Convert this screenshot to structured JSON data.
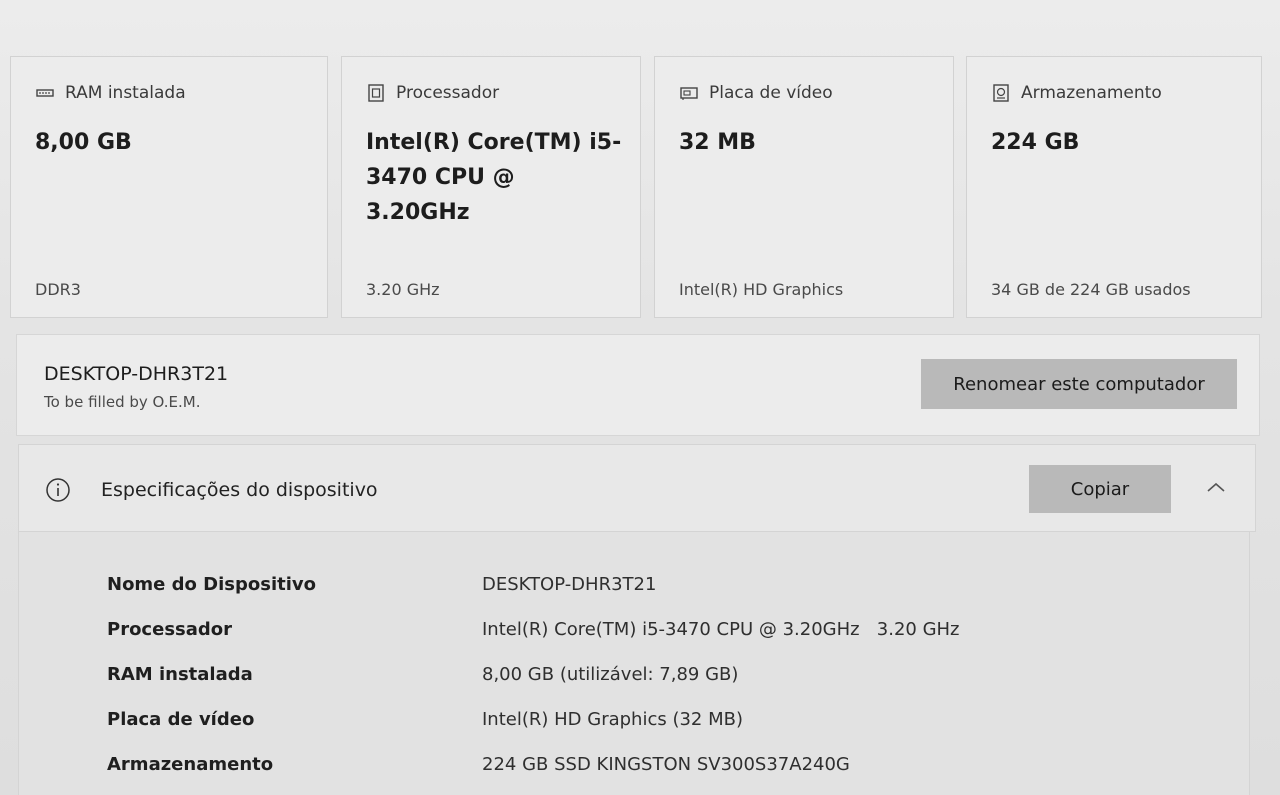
{
  "cards": [
    {
      "icon": "ram-icon",
      "title": "RAM instalada",
      "value": "8,00 GB",
      "footer": "DDR3"
    },
    {
      "icon": "processor-icon",
      "title": "Processador",
      "value": "Intel(R) Core(TM) i5-3470 CPU @ 3.20GHz",
      "footer": "3.20 GHz"
    },
    {
      "icon": "display-adapter-icon",
      "title": "Placa de vídeo",
      "value": "32 MB",
      "footer": "Intel(R) HD Graphics"
    },
    {
      "icon": "storage-icon",
      "title": "Armazenamento",
      "value": "224 GB",
      "footer": "34 GB de 224 GB usados"
    }
  ],
  "computer": {
    "name": "DESKTOP-DHR3T21",
    "subtitle": "To be filled by O.E.M.",
    "rename_label": "Renomear este computador"
  },
  "specs": {
    "title": "Especificações do dispositivo",
    "copy_label": "Copiar",
    "rows": [
      {
        "label": "Nome do Dispositivo",
        "value": "DESKTOP-DHR3T21"
      },
      {
        "label": "Processador",
        "value": "Intel(R) Core(TM) i5-3470 CPU @ 3.20GHz   3.20 GHz"
      },
      {
        "label": "RAM instalada",
        "value": "8,00 GB (utilizável: 7,89 GB)"
      },
      {
        "label": "Placa de vídeo",
        "value": "Intel(R) HD Graphics (32 MB)"
      },
      {
        "label": "Armazenamento",
        "value": "224 GB SSD KINGSTON SV300S37A240G"
      }
    ]
  }
}
